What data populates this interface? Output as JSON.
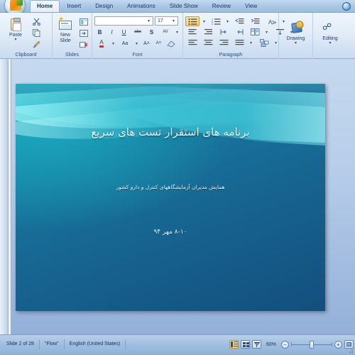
{
  "window": {
    "app": "Microsoft PowerPoint",
    "office_button": "Office Button"
  },
  "tabs": [
    {
      "label": "Home",
      "active": true
    },
    {
      "label": "Insert",
      "active": false
    },
    {
      "label": "Design",
      "active": false
    },
    {
      "label": "Animations",
      "active": false
    },
    {
      "label": "Slide Show",
      "active": false
    },
    {
      "label": "Review",
      "active": false
    },
    {
      "label": "View",
      "active": false
    }
  ],
  "ribbon": {
    "groups": [
      {
        "label": "Clipboard",
        "big": "Paste",
        "caret": "▾"
      },
      {
        "label": "Slides",
        "big": "New\nSlide",
        "caret": "▾"
      },
      {
        "label": "Font"
      },
      {
        "label": "Paragraph"
      },
      {
        "label": "Drawing"
      },
      {
        "label": "Editing"
      }
    ],
    "clipboard": {
      "paste_label": "Paste",
      "cut_label": "Cut",
      "copy_label": "Copy",
      "format_painter_label": "Format Painter"
    },
    "slides": {
      "new_slide_line1": "New",
      "new_slide_line2": "Slide",
      "layout_label": "Layout",
      "reset_label": "Reset",
      "delete_label": "Delete"
    },
    "font": {
      "font_name_value": "",
      "font_size_value": "17",
      "bold": "B",
      "italic": "I",
      "underline": "U",
      "strikethrough": "abc",
      "shadow": "S",
      "spacing": "AV",
      "font_color": "A",
      "change_case": "Aa",
      "grow_font": "A˄",
      "shrink_font": "A˅",
      "clear_formatting": "✗"
    },
    "paragraph": {
      "bullets": "Bullets",
      "numbering": "Numbering",
      "decrease_indent": "Decrease List Level",
      "increase_indent": "Increase List Level",
      "line_spacing": "Line Spacing",
      "text_direction": "Text Direction",
      "align_text": "Align Text",
      "convert_smartart": "Convert to SmartArt",
      "align_left": "Align Text Left",
      "center": "Center",
      "align_right": "Align Text Right",
      "justify": "Justify",
      "columns": "Columns",
      "ltr": "Left-to-Right",
      "rtl": "Right-to-Left"
    },
    "drawing": {
      "label": "Drawing",
      "caret": "▾"
    },
    "editing": {
      "label": "Editing",
      "caret": "▾"
    }
  },
  "slide": {
    "theme": "Flow",
    "title": "برنامه های استقرار تست های سریع",
    "subtitle": "همایش مدیران آزمایشگاههای کنترل و دارو کشور",
    "date": "۸-۱۰ مهر ۹۴"
  },
  "status": {
    "slide_counter": "Slide 2 of 28",
    "theme_name": "\"Flow\"",
    "language": "English (United States)",
    "zoom_percent": "60%",
    "zoom_out": "−",
    "zoom_in": "+",
    "view_normal": "Normal View",
    "view_sorter": "Slide Sorter",
    "view_show": "Slide Show",
    "fit_to_window": "Fit slide to current window"
  },
  "colors": {
    "ribbon_blue": "#cfe0f3",
    "slide_teal": "#17789f",
    "slide_cyan": "#6ee8ee",
    "accent_text": "#dff4fb"
  }
}
